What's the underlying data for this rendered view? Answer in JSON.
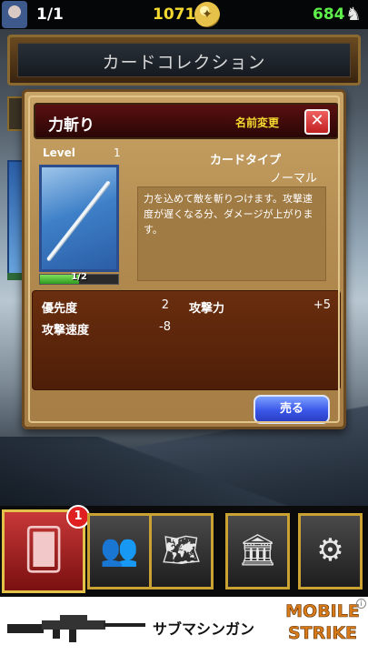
{
  "status_bar": {
    "card_count": "1/1",
    "coins": "1071",
    "gems": "684",
    "icons": {
      "avatar": "player-avatar",
      "coin": "coin-icon",
      "gem": "rabbit-icon"
    }
  },
  "header": {
    "title": "カードコレクション"
  },
  "card_dialog": {
    "name": "力斬り",
    "rename_label": "名前変更",
    "close_icon": "close-icon",
    "level_label": "Level",
    "level_value": "1",
    "exp_text": "1/2",
    "exp_progress": 0.5,
    "card_type_label": "カードタイプ",
    "card_type_value": "ノーマル",
    "description": "力を込めて敵を斬りつけます。攻撃速度が遅くなる分、ダメージが上がります。",
    "stats": [
      {
        "label": "優先度",
        "value": "2"
      },
      {
        "label": "攻撃力",
        "value": "+5"
      },
      {
        "label": "攻撃速度",
        "value": "-8"
      }
    ],
    "sell_label": "売る"
  },
  "bottom_nav": {
    "items": [
      {
        "name": "cards",
        "icon": "cards-icon",
        "active": true,
        "badge": "1"
      },
      {
        "name": "friends",
        "icon": "people-icon",
        "active": false
      },
      {
        "name": "map",
        "icon": "map-icon",
        "active": false
      },
      {
        "name": "bank",
        "icon": "bank-icon",
        "active": false
      },
      {
        "name": "settings",
        "icon": "gear-icon",
        "active": false
      }
    ]
  },
  "ad_banner": {
    "text": "サブマシンガン",
    "logo_line1": "MOBILE",
    "logo_line2": "STRIKE",
    "info_label": "i"
  },
  "colors": {
    "coins": "#f5d930",
    "gems": "#5ef04a",
    "accent_gold": "#c9a233",
    "sell_button": "#3a56e8",
    "close_button": "#c02020"
  }
}
